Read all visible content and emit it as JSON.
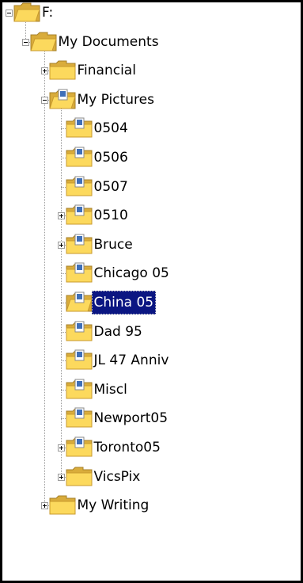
{
  "window": {
    "title": ""
  },
  "colors": {
    "selection_bg": "#0b1682",
    "folder_yellow": "#fcd95d",
    "tree_line": "#9a9a9a"
  },
  "tree": [
    {
      "label": "F:",
      "level": 0,
      "expander": "minus",
      "icon": "folder-open",
      "selected": false
    },
    {
      "label": "My Documents",
      "level": 1,
      "expander": "minus",
      "icon": "folder-open",
      "selected": false
    },
    {
      "label": "Financial",
      "level": 2,
      "expander": "plus",
      "icon": "folder",
      "selected": false
    },
    {
      "label": "My Pictures",
      "level": 2,
      "expander": "minus",
      "icon": "picture-folder-open",
      "selected": false
    },
    {
      "label": "0504",
      "level": 3,
      "expander": "none",
      "icon": "picture-folder",
      "selected": false
    },
    {
      "label": "0506",
      "level": 3,
      "expander": "none",
      "icon": "picture-folder",
      "selected": false
    },
    {
      "label": "0507",
      "level": 3,
      "expander": "none",
      "icon": "picture-folder",
      "selected": false
    },
    {
      "label": "0510",
      "level": 3,
      "expander": "plus",
      "icon": "picture-folder",
      "selected": false
    },
    {
      "label": "Bruce",
      "level": 3,
      "expander": "plus",
      "icon": "picture-folder",
      "selected": false
    },
    {
      "label": "Chicago 05",
      "level": 3,
      "expander": "none",
      "icon": "picture-folder",
      "selected": false
    },
    {
      "label": "China 05",
      "level": 3,
      "expander": "none",
      "icon": "picture-folder-open",
      "selected": true
    },
    {
      "label": "Dad 95",
      "level": 3,
      "expander": "none",
      "icon": "picture-folder",
      "selected": false
    },
    {
      "label": "JL 47 Anniv",
      "level": 3,
      "expander": "none",
      "icon": "picture-folder",
      "selected": false
    },
    {
      "label": "Miscl",
      "level": 3,
      "expander": "none",
      "icon": "picture-folder",
      "selected": false
    },
    {
      "label": "Newport05",
      "level": 3,
      "expander": "none",
      "icon": "picture-folder",
      "selected": false
    },
    {
      "label": "Toronto05",
      "level": 3,
      "expander": "plus",
      "icon": "picture-folder",
      "selected": false
    },
    {
      "label": "VicsPix",
      "level": 3,
      "expander": "plus",
      "icon": "folder",
      "selected": false
    },
    {
      "label": "My Writing",
      "level": 2,
      "expander": "plus",
      "icon": "folder",
      "selected": false
    }
  ]
}
